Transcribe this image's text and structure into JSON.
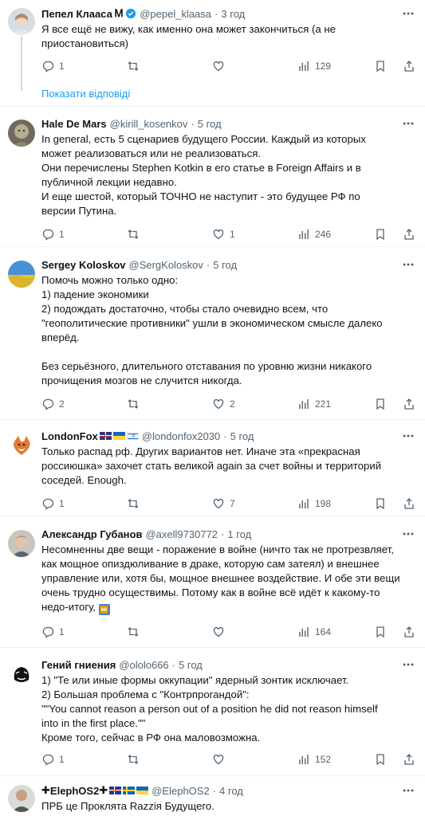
{
  "tweets": [
    {
      "name": "Пепел Клааса",
      "name_suffix": "Ꮇ",
      "handle": "@pepel_klaasa",
      "time": "3 год",
      "text": "Я все ещё не вижу, как именно она может закончиться (а не\nприостановиться)",
      "replies": "1",
      "retweets": "",
      "likes": "",
      "views": "129"
    },
    {
      "name": "Hale De Mars",
      "handle": "@kirill_kosenkov",
      "time": "5 год",
      "text": "In general, есть 5 сценариев будущего России. Каждый из которых\nможет реализоваться или не реализоваться.\nОни перечислены Stephen Kotkin в его статье в Foreign Affairs и в\nпубличной лекции недавно.\nИ еще шестой, который ТОЧНО не наступит - это будущее РФ по\nверсии Путина.",
      "replies": "1",
      "retweets": "",
      "likes": "1",
      "views": "246"
    },
    {
      "name": "Sergey Koloskov",
      "handle": "@SergKoloskov",
      "time": "5 год",
      "text": "Помочь можно только одно:\n1) падение экономики\n2) подождать достаточно, чтобы стало очевидно всем, что\n\"геополитические противники\" ушли в экономическом смысле далеко\nвперёд.\n\nБез серьёзного, длительного отставания по уровню жизни никакого\nпрочищения мозгов не случится никогда.",
      "replies": "2",
      "retweets": "",
      "likes": "2",
      "views": "221"
    },
    {
      "name": "LondonFox",
      "handle": "@londonfox2030",
      "time": "5 год",
      "text": "Только распад рф. Других вариантов нет. Иначе эта «прекрасная\nроссиюшка» захочет стать великой again за счет войны и территорий\nсоседей. Enough.",
      "replies": "1",
      "retweets": "",
      "likes": "7",
      "views": "198"
    },
    {
      "name": "Александр Губанов",
      "handle": "@axell9730772",
      "time": "1 год",
      "text": "Несомненны две вещи - поражение в войне (ничто так не протрезвляет,\nкак мощное опиздюливание в драке, которую сам затеял) и внешнее\nуправление или, хотя бы, мощное внешнее воздействие. И обе эти вещи\nочень трудно осуществимы. Потому как в войне всё идёт к какому-то\nнедо-итогу,",
      "replies": "1",
      "retweets": "",
      "likes": "",
      "views": "164"
    },
    {
      "name": "Гений гниения",
      "handle": "@ololo666",
      "time": "5 год",
      "text": "1) \"Те или иные формы оккупации\" ядерный зонтик исключает.\n2) Большая проблема с \"Контрпрогандой\":\n\"\"You cannot reason a person out of a position he did not reason himself\ninto in the first place.\"\"\nКроме того, сейчас в РФ она маловозможна.",
      "replies": "1",
      "retweets": "",
      "likes": "",
      "views": "152"
    },
    {
      "name": "ElephOS2",
      "handle": "@ElephOS2",
      "time": "4 год",
      "text": "ПРБ це Проклята Razzія Будущего."
    }
  ],
  "show_replies": "Показати відповіді",
  "colors": {
    "accent": "#1d9bf0",
    "secondary": "#536471",
    "border": "#eff3f4"
  }
}
